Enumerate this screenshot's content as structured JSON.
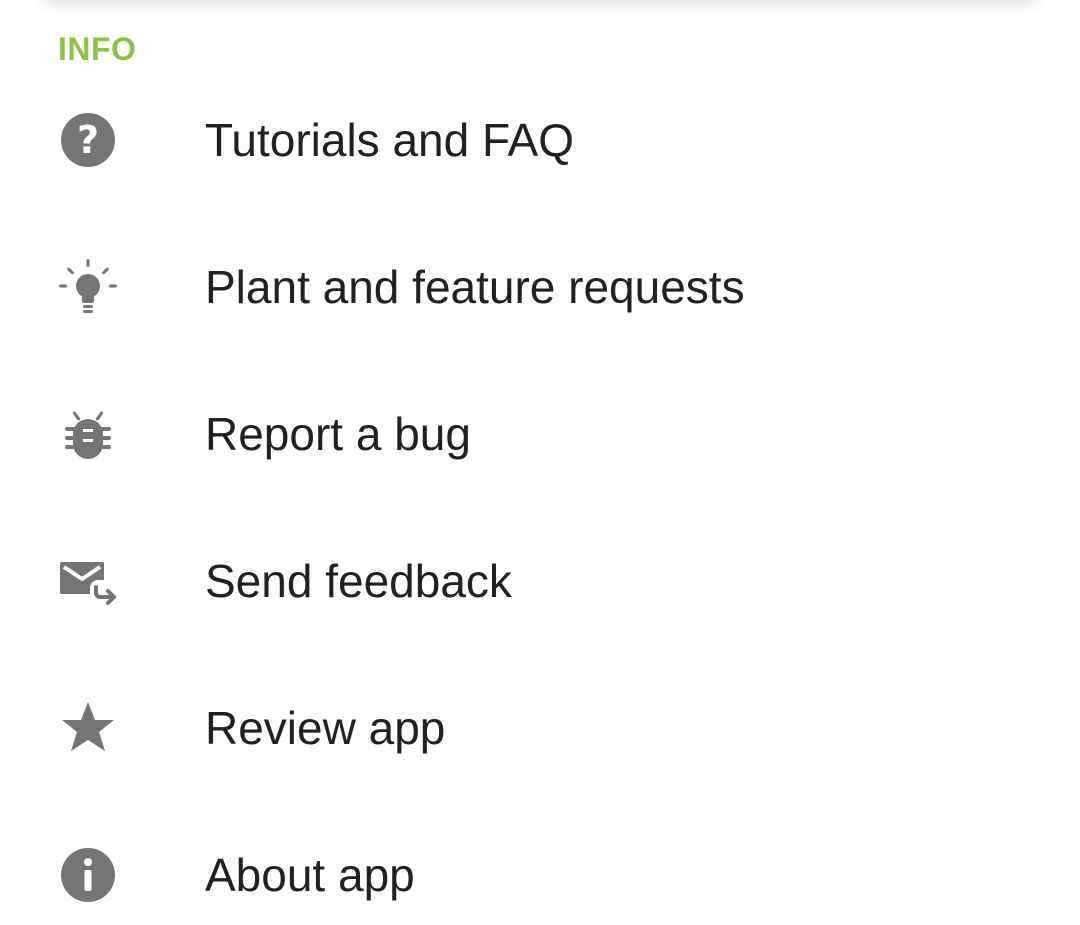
{
  "section": {
    "title": "INFO",
    "accent_color": "#8bc34a"
  },
  "icon_color": "#757575",
  "items": [
    {
      "label": "Tutorials and FAQ",
      "icon": "help-circle-icon"
    },
    {
      "label": "Plant and feature requests",
      "icon": "lightbulb-icon"
    },
    {
      "label": "Report a bug",
      "icon": "bug-icon"
    },
    {
      "label": "Send feedback",
      "icon": "email-send-icon"
    },
    {
      "label": "Review app",
      "icon": "star-icon"
    },
    {
      "label": "About app",
      "icon": "info-icon"
    }
  ]
}
